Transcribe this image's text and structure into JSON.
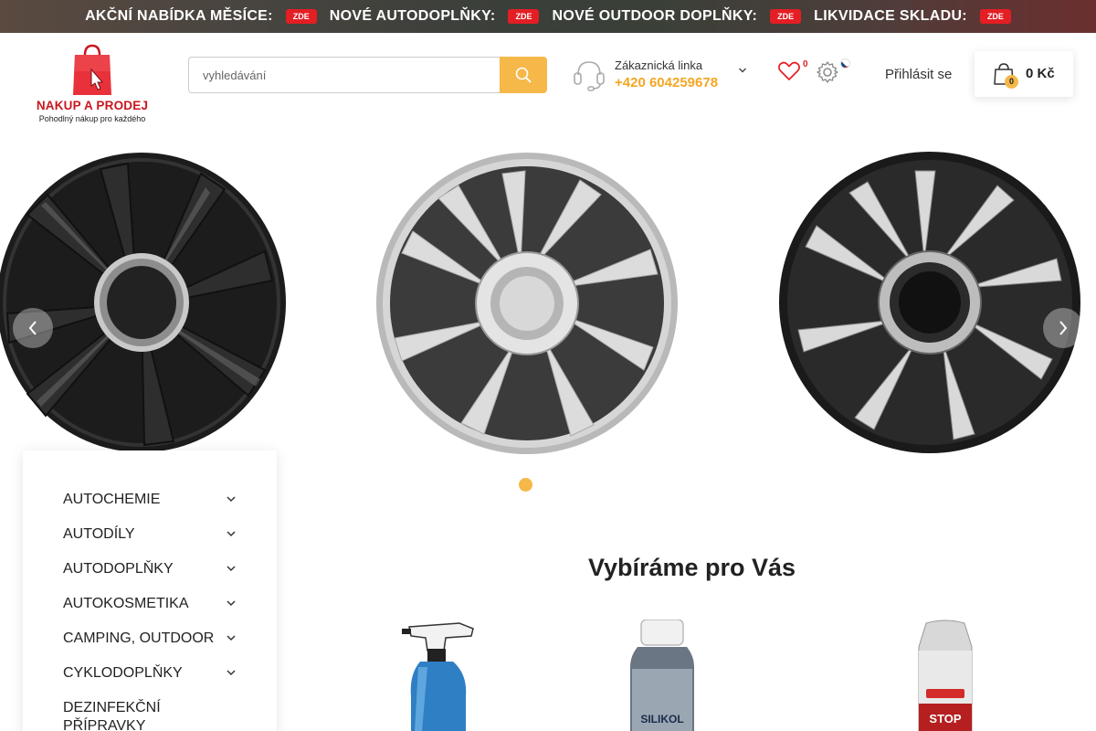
{
  "promo": [
    {
      "label": "AKČNÍ NABÍDKA MĚSÍCE:",
      "badge": "ZDE"
    },
    {
      "label": "NOVÉ AUTODOPLŇKY:",
      "badge": "ZDE"
    },
    {
      "label": "NOVÉ OUTDOOR DOPLŇKY:",
      "badge": "ZDE"
    },
    {
      "label": "LIKVIDACE SKLADU:",
      "badge": "ZDE"
    }
  ],
  "logo": {
    "title": "NAKUP A PRODEJ",
    "subtitle": "Pohodlný nákup pro každého"
  },
  "search": {
    "placeholder": "vyhledávání"
  },
  "support": {
    "label": "Zákaznická linka",
    "phone": "+420 604259678"
  },
  "wishlist": {
    "count": "0"
  },
  "login": {
    "label": "Přihlásit se"
  },
  "cart": {
    "count": "0",
    "total": "0 Kč"
  },
  "categories": [
    {
      "label": "AUTOCHEMIE"
    },
    {
      "label": "AUTODÍLY"
    },
    {
      "label": "AUTODOPLŇKY"
    },
    {
      "label": "AUTOKOSMETIKA"
    },
    {
      "label": "CAMPING, OUTDOOR"
    },
    {
      "label": "CYKLODOPLŇKY"
    },
    {
      "label": "DEZINFEKČNÍ PŘÍPRAVKY"
    }
  ],
  "section": {
    "title": "Vybíráme pro Vás"
  },
  "products": [
    {
      "label": "SILIKOL"
    },
    {
      "label": "STOP"
    }
  ],
  "colors": {
    "accent": "#f5b849",
    "brand_red": "#e31e24",
    "phone": "#f5a623"
  }
}
